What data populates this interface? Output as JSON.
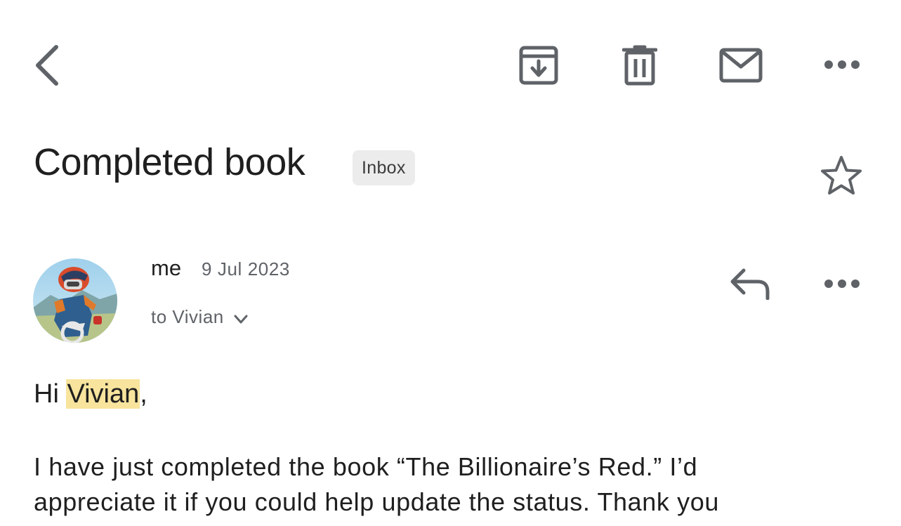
{
  "toolbar": {
    "back_icon": "chevron-left-icon",
    "archive_icon": "archive-icon",
    "delete_icon": "trash-icon",
    "mark_unread_icon": "envelope-icon",
    "more_icon": "more-horizontal-icon"
  },
  "email": {
    "subject": "Completed book",
    "label": "Inbox",
    "star_icon": "star-outline-icon",
    "message": {
      "sender": "me",
      "date": "9 Jul 2023",
      "recipients": "to Vivian",
      "reply_icon": "reply-icon",
      "more_icon": "more-horizontal-icon",
      "greeting_prefix": "Hi ",
      "greeting_name": "Vivian",
      "greeting_suffix": ",",
      "body_line1": "I have just completed the book “The Billionaire’s Red.”  I’d",
      "body_line2": "appreciate it if you could help update the status. Thank you"
    }
  },
  "colors": {
    "icon": "#5f6368",
    "highlight": "#f8e49d",
    "chip_bg": "#ececec"
  }
}
